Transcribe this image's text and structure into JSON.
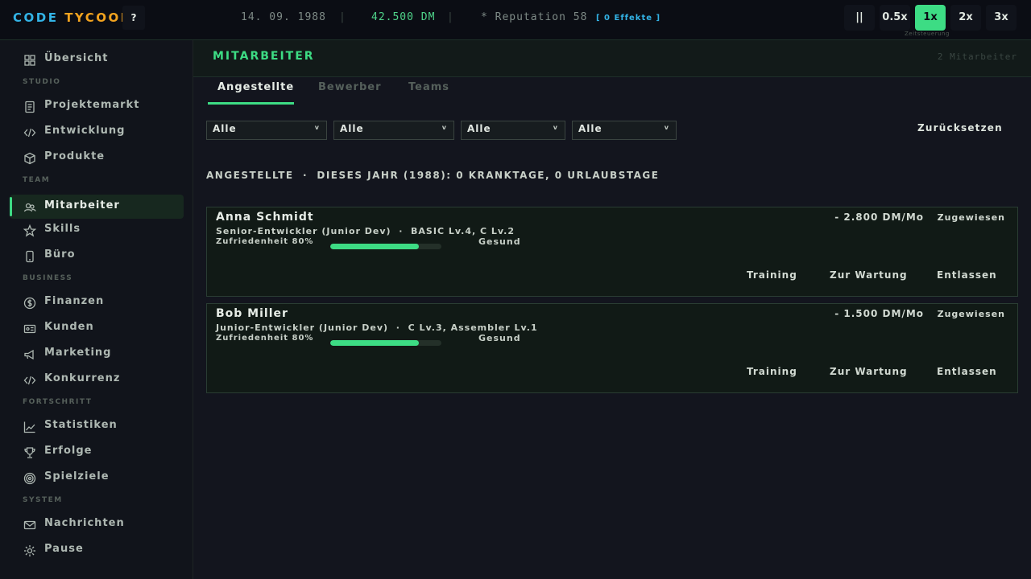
{
  "topbar": {
    "logo_part1": "CODE",
    "logo_part2": "TYCOON",
    "help_label": "?",
    "date": "14. 09. 1988",
    "separator": "|",
    "money": "42.500 DM",
    "reputation": "* Reputation 58",
    "effects": "[ 0 Effekte ]",
    "pause_label": "||",
    "speeds": [
      "0.5x",
      "1x",
      "2x",
      "3x"
    ],
    "active_speed": "1x",
    "speed_caption": "Zeitsteuerung"
  },
  "sidebar": {
    "items": [
      {
        "label": "Übersicht",
        "icon": "grid-icon"
      },
      {
        "section": "STUDIO"
      },
      {
        "label": "Projektemarkt",
        "icon": "document-icon"
      },
      {
        "label": "Entwicklung",
        "icon": "code-icon"
      },
      {
        "label": "Produkte",
        "icon": "box-icon"
      },
      {
        "section": "TEAM"
      },
      {
        "label": "Mitarbeiter",
        "icon": "people-icon",
        "active": true
      },
      {
        "label": "Skills",
        "icon": "star-icon"
      },
      {
        "label": "Büro",
        "icon": "device-icon"
      },
      {
        "section": "BUSINESS"
      },
      {
        "label": "Finanzen",
        "icon": "coin-icon"
      },
      {
        "label": "Kunden",
        "icon": "id-card-icon"
      },
      {
        "label": "Marketing",
        "icon": "megaphone-icon"
      },
      {
        "label": "Konkurrenz",
        "icon": "code-icon"
      },
      {
        "section": "FORTSCHRITT"
      },
      {
        "label": "Statistiken",
        "icon": "chart-icon"
      },
      {
        "label": "Erfolge",
        "icon": "trophy-icon"
      },
      {
        "label": "Spielziele",
        "icon": "target-icon"
      },
      {
        "section": "SYSTEM"
      },
      {
        "label": "Nachrichten",
        "icon": "mail-icon"
      },
      {
        "label": "Pause",
        "icon": "gear-icon"
      }
    ]
  },
  "main": {
    "title": "MITARBEITER",
    "count": "2 Mitarbeiter",
    "tabs": [
      {
        "label": "Angestellte",
        "active": true
      },
      {
        "label": "Bewerber"
      },
      {
        "label": "Teams"
      }
    ],
    "filters": [
      {
        "value": "Alle",
        "chevron": "v"
      },
      {
        "value": "Alle",
        "chevron": "v"
      },
      {
        "value": "Alle",
        "chevron": "v"
      },
      {
        "value": "Alle",
        "chevron": "v"
      }
    ],
    "reset_label": "Zurücksetzen",
    "section_heading": "ANGESTELLTE  ·  DIESES JAHR (1988): 0 KRANKTAGE, 0 URLAUBSTAGE",
    "employees": [
      {
        "name": "Anna Schmidt",
        "role": "Senior-Entwickler (Junior Dev)  ·  BASIC Lv.4, C Lv.2",
        "satisfaction_label": "Zufriedenheit 80%",
        "satisfaction": 0.8,
        "health": "Gesund",
        "salary": "- 2.800 DM/Mo",
        "status": "Zugewiesen",
        "actions": [
          "Training",
          "Zur Wartung",
          "Entlassen"
        ]
      },
      {
        "name": "Bob Miller",
        "role": "Junior-Entwickler (Junior Dev)  ·  C Lv.3, Assembler Lv.1",
        "satisfaction_label": "Zufriedenheit 80%",
        "satisfaction": 0.8,
        "health": "Gesund",
        "salary": "- 1.500 DM/Mo",
        "status": "Zugewiesen",
        "actions": [
          "Training",
          "Zur Wartung",
          "Entlassen"
        ]
      }
    ]
  },
  "colors": {
    "accent": "#3ddc84",
    "logo_code": "#33b3e6",
    "logo_tycoon": "#f2a31f",
    "background": "#13151e"
  }
}
